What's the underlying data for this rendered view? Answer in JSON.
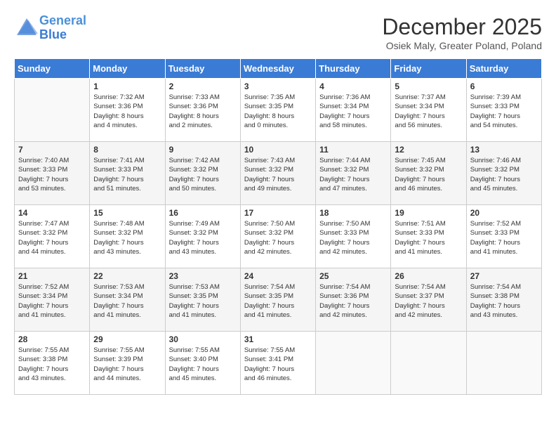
{
  "header": {
    "logo_line1": "General",
    "logo_line2": "Blue",
    "month": "December 2025",
    "location": "Osiek Maly, Greater Poland, Poland"
  },
  "days_of_week": [
    "Sunday",
    "Monday",
    "Tuesday",
    "Wednesday",
    "Thursday",
    "Friday",
    "Saturday"
  ],
  "weeks": [
    [
      {
        "day": "",
        "sunrise": "",
        "sunset": "",
        "daylight": ""
      },
      {
        "day": "1",
        "sunrise": "Sunrise: 7:32 AM",
        "sunset": "Sunset: 3:36 PM",
        "daylight": "Daylight: 8 hours and 4 minutes."
      },
      {
        "day": "2",
        "sunrise": "Sunrise: 7:33 AM",
        "sunset": "Sunset: 3:36 PM",
        "daylight": "Daylight: 8 hours and 2 minutes."
      },
      {
        "day": "3",
        "sunrise": "Sunrise: 7:35 AM",
        "sunset": "Sunset: 3:35 PM",
        "daylight": "Daylight: 8 hours and 0 minutes."
      },
      {
        "day": "4",
        "sunrise": "Sunrise: 7:36 AM",
        "sunset": "Sunset: 3:34 PM",
        "daylight": "Daylight: 7 hours and 58 minutes."
      },
      {
        "day": "5",
        "sunrise": "Sunrise: 7:37 AM",
        "sunset": "Sunset: 3:34 PM",
        "daylight": "Daylight: 7 hours and 56 minutes."
      },
      {
        "day": "6",
        "sunrise": "Sunrise: 7:39 AM",
        "sunset": "Sunset: 3:33 PM",
        "daylight": "Daylight: 7 hours and 54 minutes."
      }
    ],
    [
      {
        "day": "7",
        "sunrise": "Sunrise: 7:40 AM",
        "sunset": "Sunset: 3:33 PM",
        "daylight": "Daylight: 7 hours and 53 minutes."
      },
      {
        "day": "8",
        "sunrise": "Sunrise: 7:41 AM",
        "sunset": "Sunset: 3:33 PM",
        "daylight": "Daylight: 7 hours and 51 minutes."
      },
      {
        "day": "9",
        "sunrise": "Sunrise: 7:42 AM",
        "sunset": "Sunset: 3:32 PM",
        "daylight": "Daylight: 7 hours and 50 minutes."
      },
      {
        "day": "10",
        "sunrise": "Sunrise: 7:43 AM",
        "sunset": "Sunset: 3:32 PM",
        "daylight": "Daylight: 7 hours and 49 minutes."
      },
      {
        "day": "11",
        "sunrise": "Sunrise: 7:44 AM",
        "sunset": "Sunset: 3:32 PM",
        "daylight": "Daylight: 7 hours and 47 minutes."
      },
      {
        "day": "12",
        "sunrise": "Sunrise: 7:45 AM",
        "sunset": "Sunset: 3:32 PM",
        "daylight": "Daylight: 7 hours and 46 minutes."
      },
      {
        "day": "13",
        "sunrise": "Sunrise: 7:46 AM",
        "sunset": "Sunset: 3:32 PM",
        "daylight": "Daylight: 7 hours and 45 minutes."
      }
    ],
    [
      {
        "day": "14",
        "sunrise": "Sunrise: 7:47 AM",
        "sunset": "Sunset: 3:32 PM",
        "daylight": "Daylight: 7 hours and 44 minutes."
      },
      {
        "day": "15",
        "sunrise": "Sunrise: 7:48 AM",
        "sunset": "Sunset: 3:32 PM",
        "daylight": "Daylight: 7 hours and 43 minutes."
      },
      {
        "day": "16",
        "sunrise": "Sunrise: 7:49 AM",
        "sunset": "Sunset: 3:32 PM",
        "daylight": "Daylight: 7 hours and 43 minutes."
      },
      {
        "day": "17",
        "sunrise": "Sunrise: 7:50 AM",
        "sunset": "Sunset: 3:32 PM",
        "daylight": "Daylight: 7 hours and 42 minutes."
      },
      {
        "day": "18",
        "sunrise": "Sunrise: 7:50 AM",
        "sunset": "Sunset: 3:33 PM",
        "daylight": "Daylight: 7 hours and 42 minutes."
      },
      {
        "day": "19",
        "sunrise": "Sunrise: 7:51 AM",
        "sunset": "Sunset: 3:33 PM",
        "daylight": "Daylight: 7 hours and 41 minutes."
      },
      {
        "day": "20",
        "sunrise": "Sunrise: 7:52 AM",
        "sunset": "Sunset: 3:33 PM",
        "daylight": "Daylight: 7 hours and 41 minutes."
      }
    ],
    [
      {
        "day": "21",
        "sunrise": "Sunrise: 7:52 AM",
        "sunset": "Sunset: 3:34 PM",
        "daylight": "Daylight: 7 hours and 41 minutes."
      },
      {
        "day": "22",
        "sunrise": "Sunrise: 7:53 AM",
        "sunset": "Sunset: 3:34 PM",
        "daylight": "Daylight: 7 hours and 41 minutes."
      },
      {
        "day": "23",
        "sunrise": "Sunrise: 7:53 AM",
        "sunset": "Sunset: 3:35 PM",
        "daylight": "Daylight: 7 hours and 41 minutes."
      },
      {
        "day": "24",
        "sunrise": "Sunrise: 7:54 AM",
        "sunset": "Sunset: 3:35 PM",
        "daylight": "Daylight: 7 hours and 41 minutes."
      },
      {
        "day": "25",
        "sunrise": "Sunrise: 7:54 AM",
        "sunset": "Sunset: 3:36 PM",
        "daylight": "Daylight: 7 hours and 42 minutes."
      },
      {
        "day": "26",
        "sunrise": "Sunrise: 7:54 AM",
        "sunset": "Sunset: 3:37 PM",
        "daylight": "Daylight: 7 hours and 42 minutes."
      },
      {
        "day": "27",
        "sunrise": "Sunrise: 7:54 AM",
        "sunset": "Sunset: 3:38 PM",
        "daylight": "Daylight: 7 hours and 43 minutes."
      }
    ],
    [
      {
        "day": "28",
        "sunrise": "Sunrise: 7:55 AM",
        "sunset": "Sunset: 3:38 PM",
        "daylight": "Daylight: 7 hours and 43 minutes."
      },
      {
        "day": "29",
        "sunrise": "Sunrise: 7:55 AM",
        "sunset": "Sunset: 3:39 PM",
        "daylight": "Daylight: 7 hours and 44 minutes."
      },
      {
        "day": "30",
        "sunrise": "Sunrise: 7:55 AM",
        "sunset": "Sunset: 3:40 PM",
        "daylight": "Daylight: 7 hours and 45 minutes."
      },
      {
        "day": "31",
        "sunrise": "Sunrise: 7:55 AM",
        "sunset": "Sunset: 3:41 PM",
        "daylight": "Daylight: 7 hours and 46 minutes."
      },
      {
        "day": "",
        "sunrise": "",
        "sunset": "",
        "daylight": ""
      },
      {
        "day": "",
        "sunrise": "",
        "sunset": "",
        "daylight": ""
      },
      {
        "day": "",
        "sunrise": "",
        "sunset": "",
        "daylight": ""
      }
    ]
  ]
}
